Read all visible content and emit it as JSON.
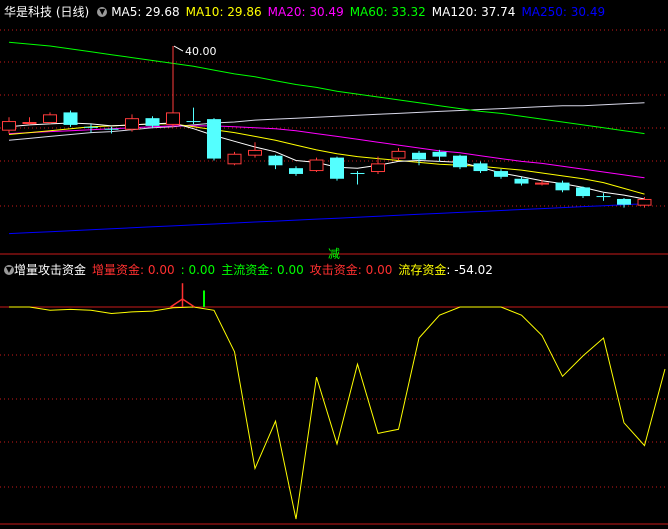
{
  "main_legend": {
    "title": "华是科技 (日线)",
    "items": [
      {
        "label": "MA5: 29.68",
        "color": "#ffffff"
      },
      {
        "label": "MA10: 29.86",
        "color": "#ffff00"
      },
      {
        "label": "MA20: 30.49",
        "color": "#ff00ff"
      },
      {
        "label": "MA60: 33.32",
        "color": "#00ff00"
      },
      {
        "label": "MA120: 37.74",
        "color": "#ffffff"
      },
      {
        "label": "MA250: 30.49",
        "color": "#0000ff"
      }
    ]
  },
  "indicator_legend": {
    "title": "增量攻击资金",
    "items": [
      {
        "label": "增量资金",
        "value": ": 0.00",
        "label_color": "#ff3030",
        "value_color": "#ff3030"
      },
      {
        "label": "",
        "value": ": 0.00",
        "label_color": "#00ff00",
        "value_color": "#00ff00"
      },
      {
        "label": "主流资金",
        "value": ": 0.00",
        "label_color": "#00ff00",
        "value_color": "#00ff00"
      },
      {
        "label": "攻击资金",
        "value": ": 0.00",
        "label_color": "#ff3030",
        "value_color": "#ff3030"
      },
      {
        "label": "流存资金",
        "value": ": -54.02",
        "label_color": "#ffff00",
        "value_color": "#ffffff"
      }
    ]
  },
  "marker_label": "减",
  "colors": {
    "up": "#ff3b3b",
    "down": "#54ffff",
    "grid": "#c81a1a",
    "bg": "#000000",
    "flow": "#ffff00"
  },
  "chart_data": [
    {
      "type": "candlestick",
      "max_label": "40.00",
      "candles": [
        {
          "o": 31.2,
          "c": 32.2,
          "h": 32.6,
          "l": 30.9
        },
        {
          "o": 32.0,
          "c": 32.1,
          "h": 32.6,
          "l": 31.8
        },
        {
          "o": 32.0,
          "c": 32.9,
          "h": 33.1,
          "l": 31.9
        },
        {
          "o": 33.1,
          "c": 31.8,
          "h": 33.3,
          "l": 31.6
        },
        {
          "o": 31.6,
          "c": 31.5,
          "h": 31.9,
          "l": 31.0
        },
        {
          "o": 31.4,
          "c": 31.3,
          "h": 31.6,
          "l": 30.9
        },
        {
          "o": 31.3,
          "c": 32.5,
          "h": 32.9,
          "l": 31.1
        },
        {
          "o": 32.5,
          "c": 31.7,
          "h": 32.7,
          "l": 31.5
        },
        {
          "o": 31.8,
          "c": 33.1,
          "h": 40.0,
          "l": 31.6
        },
        {
          "o": 32.2,
          "c": 32.1,
          "h": 33.6,
          "l": 31.9
        },
        {
          "o": 32.4,
          "c": 28.3,
          "h": 32.5,
          "l": 28.1
        },
        {
          "o": 27.7,
          "c": 28.8,
          "h": 29.0,
          "l": 27.6
        },
        {
          "o": 28.6,
          "c": 29.2,
          "h": 30.0,
          "l": 28.4
        },
        {
          "o": 28.6,
          "c": 27.6,
          "h": 28.7,
          "l": 27.2
        },
        {
          "o": 27.3,
          "c": 26.7,
          "h": 27.5,
          "l": 26.5
        },
        {
          "o": 27.0,
          "c": 28.2,
          "h": 28.4,
          "l": 26.9
        },
        {
          "o": 28.4,
          "c": 26.2,
          "h": 28.5,
          "l": 26.0
        },
        {
          "o": 26.8,
          "c": 26.7,
          "h": 27.0,
          "l": 25.6
        },
        {
          "o": 26.9,
          "c": 27.8,
          "h": 28.5,
          "l": 26.7
        },
        {
          "o": 28.3,
          "c": 29.1,
          "h": 29.4,
          "l": 28.1
        },
        {
          "o": 28.9,
          "c": 28.2,
          "h": 29.1,
          "l": 27.6
        },
        {
          "o": 29.0,
          "c": 28.5,
          "h": 29.2,
          "l": 28.0
        },
        {
          "o": 28.6,
          "c": 27.4,
          "h": 28.7,
          "l": 27.2
        },
        {
          "o": 27.8,
          "c": 27.0,
          "h": 28.0,
          "l": 26.8
        },
        {
          "o": 27.0,
          "c": 26.4,
          "h": 27.2,
          "l": 26.2
        },
        {
          "o": 26.2,
          "c": 25.7,
          "h": 26.4,
          "l": 25.5
        },
        {
          "o": 25.7,
          "c": 25.8,
          "h": 26.1,
          "l": 25.5
        },
        {
          "o": 25.8,
          "c": 25.0,
          "h": 26.0,
          "l": 24.8
        },
        {
          "o": 25.3,
          "c": 24.4,
          "h": 25.4,
          "l": 24.2
        },
        {
          "o": 24.4,
          "c": 24.3,
          "h": 24.7,
          "l": 23.9
        },
        {
          "o": 24.1,
          "c": 23.5,
          "h": 24.2,
          "l": 23.2
        },
        {
          "o": 23.4,
          "c": 24.1,
          "h": 24.3,
          "l": 23.2
        }
      ],
      "ma5": [
        31.6,
        31.8,
        31.9,
        32.0,
        31.9,
        31.7,
        31.8,
        31.9,
        32.0,
        31.4,
        30.7,
        30.1,
        29.5,
        29.0,
        28.1,
        27.9,
        27.4,
        27.3,
        27.6,
        28.0,
        28.1,
        28.0,
        27.9,
        27.4,
        26.8,
        26.4,
        26.0,
        25.7,
        25.3,
        24.8,
        24.5,
        24.1
      ],
      "ma10": [
        30.8,
        31.0,
        31.2,
        31.4,
        31.6,
        31.7,
        31.8,
        31.9,
        31.9,
        31.6,
        31.3,
        31.0,
        30.6,
        30.2,
        29.7,
        29.2,
        28.8,
        28.5,
        28.3,
        28.1,
        27.9,
        27.7,
        27.6,
        27.5,
        27.3,
        27.1,
        26.8,
        26.5,
        26.2,
        25.8,
        25.2,
        24.6
      ],
      "ma20": [
        30.9,
        31.0,
        31.1,
        31.2,
        31.3,
        31.4,
        31.5,
        31.6,
        31.7,
        31.7,
        31.7,
        31.6,
        31.5,
        31.4,
        31.2,
        30.9,
        30.6,
        30.3,
        30.0,
        29.7,
        29.4,
        29.1,
        28.9,
        28.6,
        28.3,
        28.0,
        27.8,
        27.5,
        27.2,
        26.9,
        26.6,
        26.3
      ],
      "ma60": [
        40.4,
        40.2,
        40.0,
        39.7,
        39.4,
        39.1,
        38.8,
        38.5,
        38.2,
        37.9,
        37.5,
        37.1,
        36.8,
        36.4,
        36.0,
        35.7,
        35.3,
        35.0,
        34.7,
        34.4,
        34.1,
        33.8,
        33.5,
        33.2,
        33.0,
        32.7,
        32.4,
        32.1,
        31.8,
        31.5,
        31.2,
        30.9
      ],
      "ma120": [
        30.2,
        30.4,
        30.6,
        30.8,
        31.0,
        31.1,
        31.3,
        31.5,
        31.6,
        31.8,
        32.0,
        32.1,
        32.3,
        32.4,
        32.5,
        32.6,
        32.7,
        32.8,
        32.9,
        33.0,
        33.1,
        33.2,
        33.3,
        33.4,
        33.5,
        33.6,
        33.7,
        33.8,
        33.8,
        33.9,
        34.0,
        34.1
      ],
      "ma250": [
        20.5,
        20.6,
        20.7,
        20.8,
        20.9,
        21.0,
        21.1,
        21.2,
        21.3,
        21.4,
        21.5,
        21.6,
        21.7,
        21.8,
        21.9,
        22.0,
        22.1,
        22.2,
        22.3,
        22.4,
        22.5,
        22.6,
        22.7,
        22.8,
        22.9,
        23.0,
        23.1,
        23.2,
        23.3,
        23.4,
        23.5,
        23.6
      ]
    },
    {
      "type": "line",
      "name": "流存资金",
      "values": [
        0,
        0,
        -4,
        -3,
        -4,
        -8,
        -6,
        -5,
        -1,
        0,
        -4,
        -55,
        -198,
        -140,
        -260,
        -86,
        -168,
        -70,
        -155,
        -150,
        -38,
        -10,
        0,
        0,
        0,
        -10,
        -35,
        -85,
        -60,
        -38,
        -142,
        -170,
        -76
      ],
      "spikes": [
        {
          "index": 9,
          "value": 12,
          "color": "#ff3030"
        },
        {
          "index": 10,
          "value": 8,
          "color": "#00ff00"
        }
      ]
    }
  ]
}
